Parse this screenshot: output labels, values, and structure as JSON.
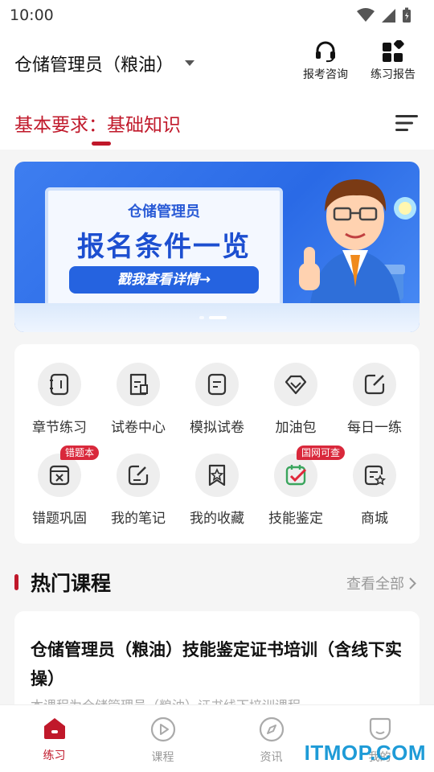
{
  "status_bar": {
    "time": "10:00"
  },
  "header": {
    "job_title": "仓储管理员（粮油）",
    "consult_label": "报考咨询",
    "report_label": "练习报告"
  },
  "tab_line": {
    "requirement_text": "基本要求：基础知识"
  },
  "banner": {
    "subtitle": "仓储管理员",
    "title": "报名条件一览",
    "cta": "戳我查看详情→",
    "active_slide": 2,
    "slide_count": 2
  },
  "features": [
    {
      "label": "章节练习",
      "icon": "chapter-icon"
    },
    {
      "label": "试卷中心",
      "icon": "paper-icon"
    },
    {
      "label": "模拟试卷",
      "icon": "mock-paper-icon"
    },
    {
      "label": "加油包",
      "icon": "diamond-icon"
    },
    {
      "label": "每日一练",
      "icon": "daily-edit-icon"
    },
    {
      "label": "错题巩固",
      "icon": "wrong-box-icon",
      "badge": "错题本"
    },
    {
      "label": "我的笔记",
      "icon": "note-icon"
    },
    {
      "label": "我的收藏",
      "icon": "star-bookmark-icon"
    },
    {
      "label": "技能鉴定",
      "icon": "check-calendar-icon",
      "badge": "国网可查"
    },
    {
      "label": "商城",
      "icon": "shop-list-icon"
    }
  ],
  "hot_courses": {
    "title": "热门课程",
    "see_all": "查看全部",
    "items": [
      {
        "title": "仓储管理员（粮油）技能鉴定证书培训（含线下实操）",
        "description": "本课程为仓储管理员（粮油）证书线下培训课程"
      }
    ]
  },
  "bottom_nav": [
    {
      "label": "练习",
      "icon": "home-icon",
      "active": true
    },
    {
      "label": "课程",
      "icon": "play-circle-icon",
      "active": false
    },
    {
      "label": "资讯",
      "icon": "compass-icon",
      "active": false
    },
    {
      "label": "我的",
      "icon": "profile-icon",
      "active": false
    }
  ],
  "colors": {
    "accent": "#c0182a",
    "banner_blue": "#2a6ae6",
    "badge_red": "#d9283b"
  },
  "watermark": "ITMOP.COM"
}
